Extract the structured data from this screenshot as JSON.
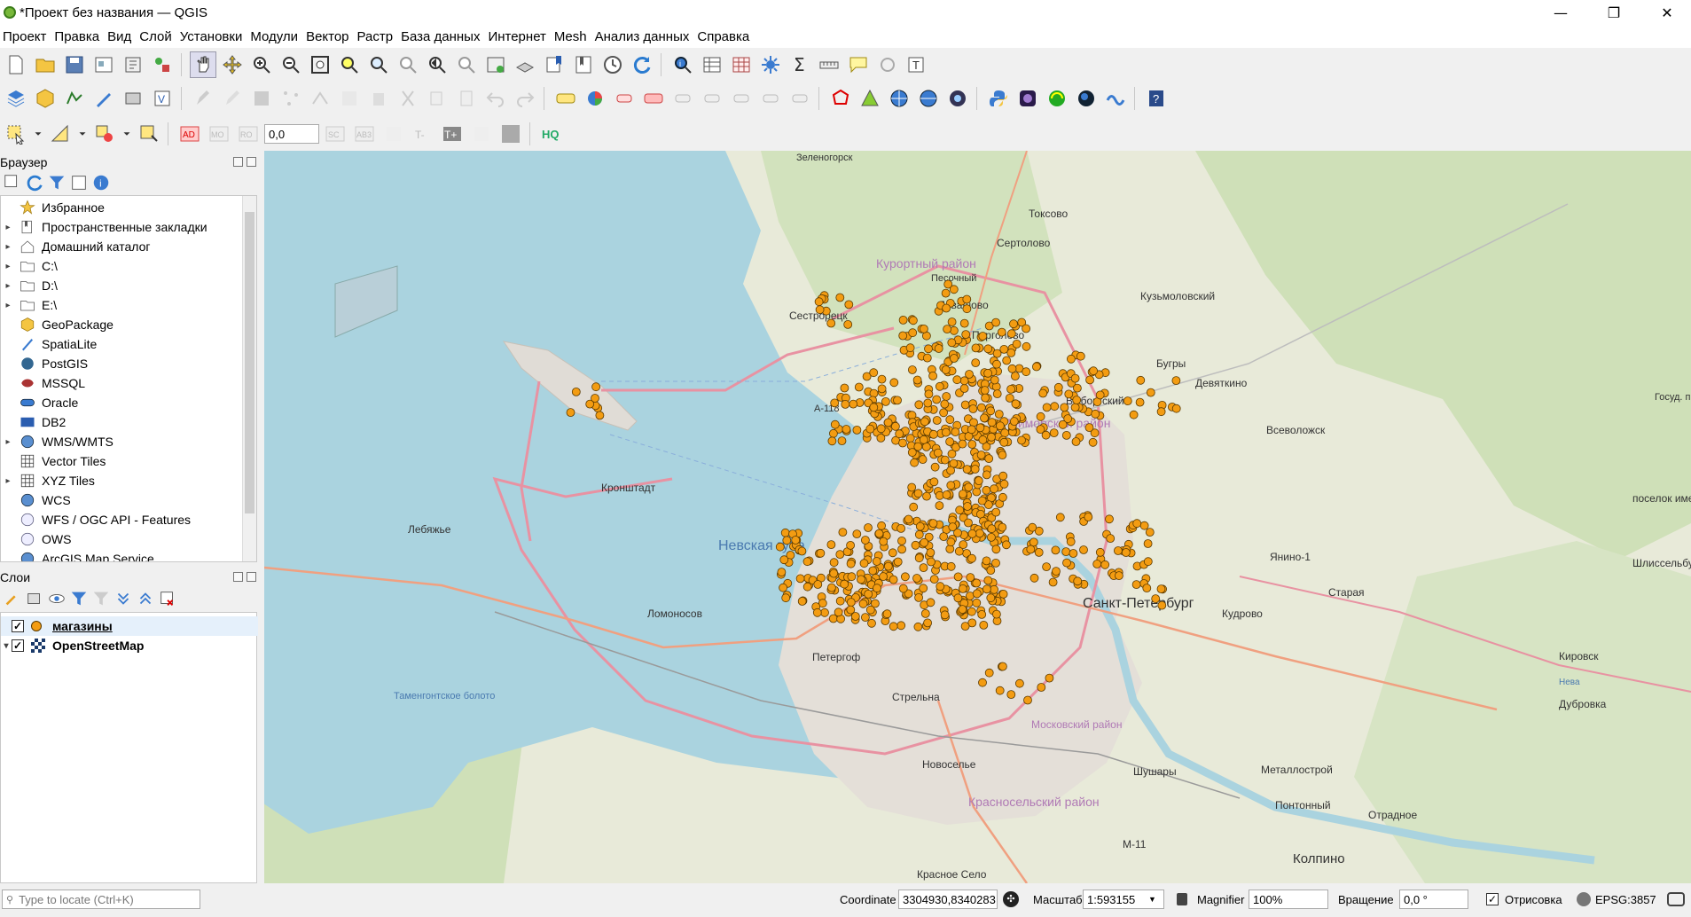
{
  "window": {
    "title": "*Проект без названия — QGIS",
    "minimize_glyph": "—",
    "restore_glyph": "❐",
    "close_glyph": "✕"
  },
  "menu": [
    "Проект",
    "Правка",
    "Вид",
    "Слой",
    "Установки",
    "Модули",
    "Вектор",
    "Растр",
    "База данных",
    "Интернет",
    "Mesh",
    "Анализ данных",
    "Справка"
  ],
  "toolbar3": {
    "rotation_value": "0,0"
  },
  "browser_panel": {
    "title": "Браузер",
    "items": [
      {
        "label": "Избранное",
        "icon": "star-icon",
        "expandable": false
      },
      {
        "label": "Пространственные закладки",
        "icon": "bookmarks-icon",
        "expandable": true
      },
      {
        "label": "Домашний каталог",
        "icon": "home-folder-icon",
        "expandable": true
      },
      {
        "label": "C:\\",
        "icon": "folder-icon",
        "expandable": true
      },
      {
        "label": "D:\\",
        "icon": "folder-icon",
        "expandable": true
      },
      {
        "label": "E:\\",
        "icon": "folder-icon",
        "expandable": true
      },
      {
        "label": "GeoPackage",
        "icon": "geopackage-icon",
        "expandable": false
      },
      {
        "label": "SpatiaLite",
        "icon": "spatialite-icon",
        "expandable": false
      },
      {
        "label": "PostGIS",
        "icon": "postgis-icon",
        "expandable": false
      },
      {
        "label": "MSSQL",
        "icon": "mssql-icon",
        "expandable": false
      },
      {
        "label": "Oracle",
        "icon": "oracle-icon",
        "expandable": false
      },
      {
        "label": "DB2",
        "icon": "db2-icon",
        "expandable": false
      },
      {
        "label": "WMS/WMTS",
        "icon": "wms-icon",
        "expandable": true
      },
      {
        "label": "Vector Tiles",
        "icon": "vector-tiles-icon",
        "expandable": false
      },
      {
        "label": "XYZ Tiles",
        "icon": "xyz-tiles-icon",
        "expandable": true
      },
      {
        "label": "WCS",
        "icon": "wcs-icon",
        "expandable": false
      },
      {
        "label": "WFS / OGC API - Features",
        "icon": "wfs-icon",
        "expandable": false
      },
      {
        "label": "OWS",
        "icon": "ows-icon",
        "expandable": false
      },
      {
        "label": "ArcGIS Map Service",
        "icon": "arcgis-icon",
        "expandable": false
      }
    ]
  },
  "layers_panel": {
    "title": "Слои",
    "layers": [
      {
        "name": "магазины",
        "visible": true,
        "selected": true,
        "symbol": "orange-point"
      },
      {
        "name": "OpenStreetMap",
        "visible": true,
        "selected": false,
        "symbol": "raster-tiles"
      }
    ]
  },
  "map": {
    "colors": {
      "water": "#aad3df",
      "land": "#e8ead9",
      "forest": "#c8dcb0",
      "urban": "#e0dcd6",
      "point_fill": "#f39c12",
      "point_stroke": "#5a3a00",
      "road_primary": "#e892a2",
      "road_trunk": "#f0a080"
    },
    "labels": [
      "Зеленогорск",
      "Токсово",
      "Сертолово",
      "Курортный район",
      "Песочный",
      "Кузьмоловский",
      "Левашово",
      "Сестрорецк",
      "Парголово",
      "Бугры",
      "Девяткино",
      "Выборгский",
      "Приморский район",
      "А-118",
      "Всеволожск",
      "Кронштадт",
      "Лебяжье",
      "Невская губа",
      "поселок имени Морозова",
      "Янино-1",
      "Старая",
      "Шлиссельбург",
      "Санкт-Петербург",
      "Кудрово",
      "Ломоносов",
      "Петергоф",
      "Стрельна",
      "Кировск",
      "Таменгонтское болото",
      "Московский район",
      "Дубровка",
      "Нева",
      "Новоселье",
      "Шушары",
      "Металлострой",
      "Красносельский район",
      "Понтонный",
      "Отрадное",
      "М-11",
      "Колпино",
      "Красное Село",
      "Госуд. прир. региональный Кокк."
    ]
  },
  "status": {
    "locate_placeholder": "Type to locate (Ctrl+K)",
    "coordinate_label": "Coordinate",
    "coordinate_value": "3304930,8340283",
    "scale_label": "Масштаб",
    "scale_value": "1:593155",
    "magnifier_label": "Magnifier",
    "magnifier_value": "100%",
    "rotation_label": "Вращение",
    "rotation_value": "0,0 °",
    "render_label": "Отрисовка",
    "render_checked": true,
    "crs": "EPSG:3857"
  }
}
